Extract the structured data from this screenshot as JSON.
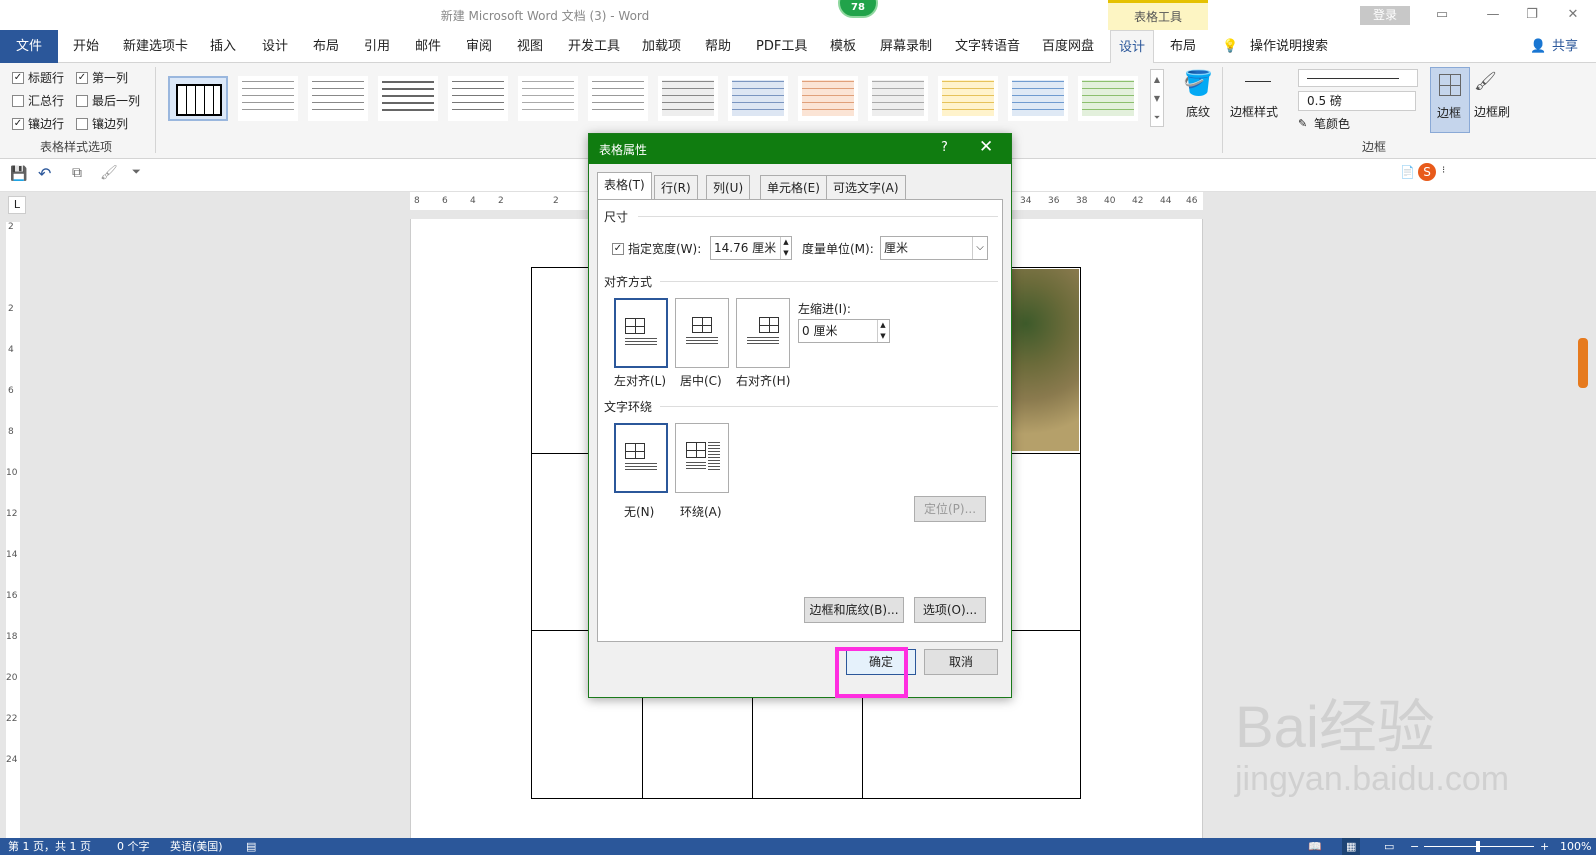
{
  "window": {
    "title": "新建 Microsoft Word 文档 (3)  -  Word",
    "tool_tab_group": "表格工具",
    "login": "登录",
    "badge": "78"
  },
  "tabs": {
    "file": "文件",
    "items": [
      "开始",
      "新建选项卡",
      "插入",
      "设计",
      "布局",
      "引用",
      "邮件",
      "审阅",
      "视图",
      "开发工具",
      "加载项",
      "帮助",
      "PDF工具",
      "模板",
      "屏幕录制",
      "文字转语音",
      "百度网盘"
    ],
    "design": "设计",
    "layout": "布局",
    "tell_me": "操作说明搜索",
    "share": "共享"
  },
  "ribbon": {
    "style_options": {
      "header_row": "标题行",
      "first_col": "第一列",
      "total_row": "汇总行",
      "last_col": "最后一列",
      "banded_rows": "镶边行",
      "banded_cols": "镶边列",
      "group_label": "表格样式选项"
    },
    "shading": "底纹",
    "border_styles": "边框样式",
    "pen_weight": "0.5 磅",
    "pen_color": "笔颜色",
    "borders": "边框",
    "border_painter": "边框刷",
    "borders_group": "边框"
  },
  "ruler": {
    "h_ticks": [
      "8",
      "6",
      "4",
      "2",
      "2",
      "34",
      "36",
      "38",
      "40",
      "42",
      "44",
      "46"
    ],
    "v_ticks": [
      "2",
      "2",
      "4",
      "6",
      "8",
      "10",
      "12",
      "14",
      "16",
      "18",
      "20",
      "22",
      "24"
    ]
  },
  "dialog": {
    "title": "表格属性",
    "help": "?",
    "tabs": [
      "表格(T)",
      "行(R)",
      "列(U)",
      "单元格(E)",
      "可选文字(A)"
    ],
    "size_section": "尺寸",
    "specify_width": "指定宽度(W):",
    "width_value": "14.76 厘米",
    "measure_in": "度量单位(M):",
    "measure_value": "厘米",
    "alignment_section": "对齐方式",
    "align_left": "左对齐(L)",
    "align_center": "居中(C)",
    "align_right": "右对齐(H)",
    "indent_label": "左缩进(I):",
    "indent_value": "0 厘米",
    "wrapping_section": "文字环绕",
    "wrap_none": "无(N)",
    "wrap_around": "环绕(A)",
    "positioning": "定位(P)...",
    "borders_shading": "边框和底纹(B)...",
    "options": "选项(O)...",
    "ok": "确定",
    "cancel": "取消"
  },
  "status": {
    "page": "第 1 页，共 1 页",
    "words": "0 个字",
    "language": "英语(美国)",
    "zoom": "100%"
  },
  "watermark": {
    "brand": "Bai经验",
    "url": "jingyan.baidu.com"
  }
}
